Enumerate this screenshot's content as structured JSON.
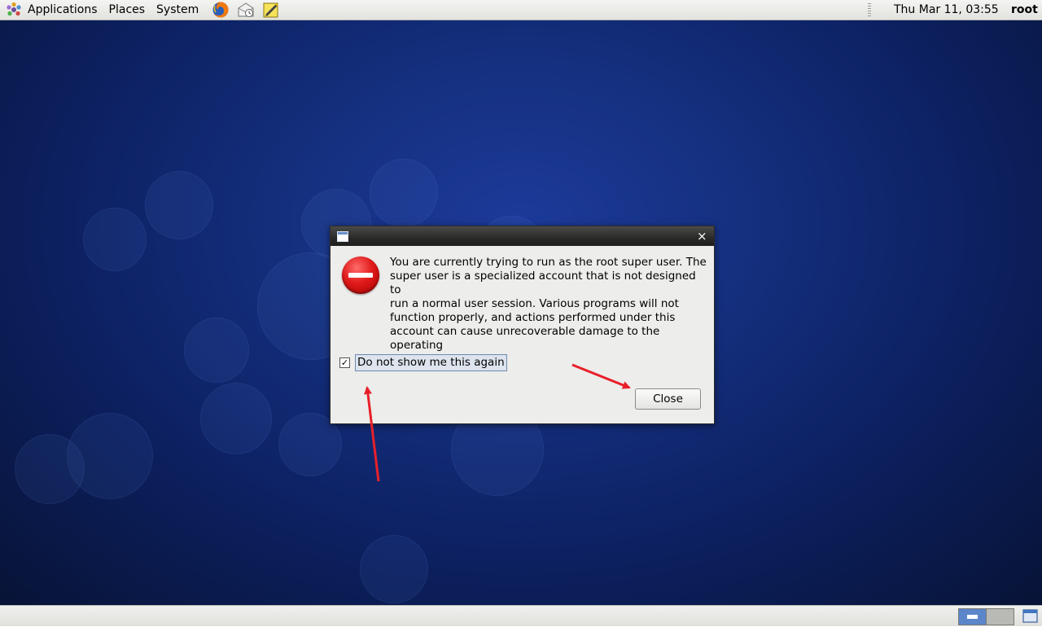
{
  "top_panel": {
    "menus": [
      "Applications",
      "Places",
      "System"
    ],
    "launchers": [
      "firefox-icon",
      "mail-clock-icon",
      "notes-edit-icon"
    ],
    "clock": "Thu Mar 11, 03:55",
    "user": "root"
  },
  "dialog": {
    "title": "",
    "icon": "error-stop-icon",
    "message": "You are currently trying to run as the root super user.  The\nsuper user is a specialized account that is not designed to\nrun a normal user session.  Various programs will not\nfunction properly, and actions performed under this\naccount can cause unrecoverable damage to the operating\nsystem.",
    "checkbox": {
      "label": "Do not show me this again",
      "checked": true,
      "mark": "✓"
    },
    "close_button": "Close",
    "titlebar_close": "×"
  },
  "bottom_panel": {
    "workspaces": [
      {
        "name": "workspace-1",
        "active": true
      },
      {
        "name": "workspace-2",
        "active": false
      }
    ]
  },
  "colors": {
    "desktop": "#15307f",
    "annotation_arrow": "#e8202a",
    "error_icon": "#e11a1a"
  }
}
